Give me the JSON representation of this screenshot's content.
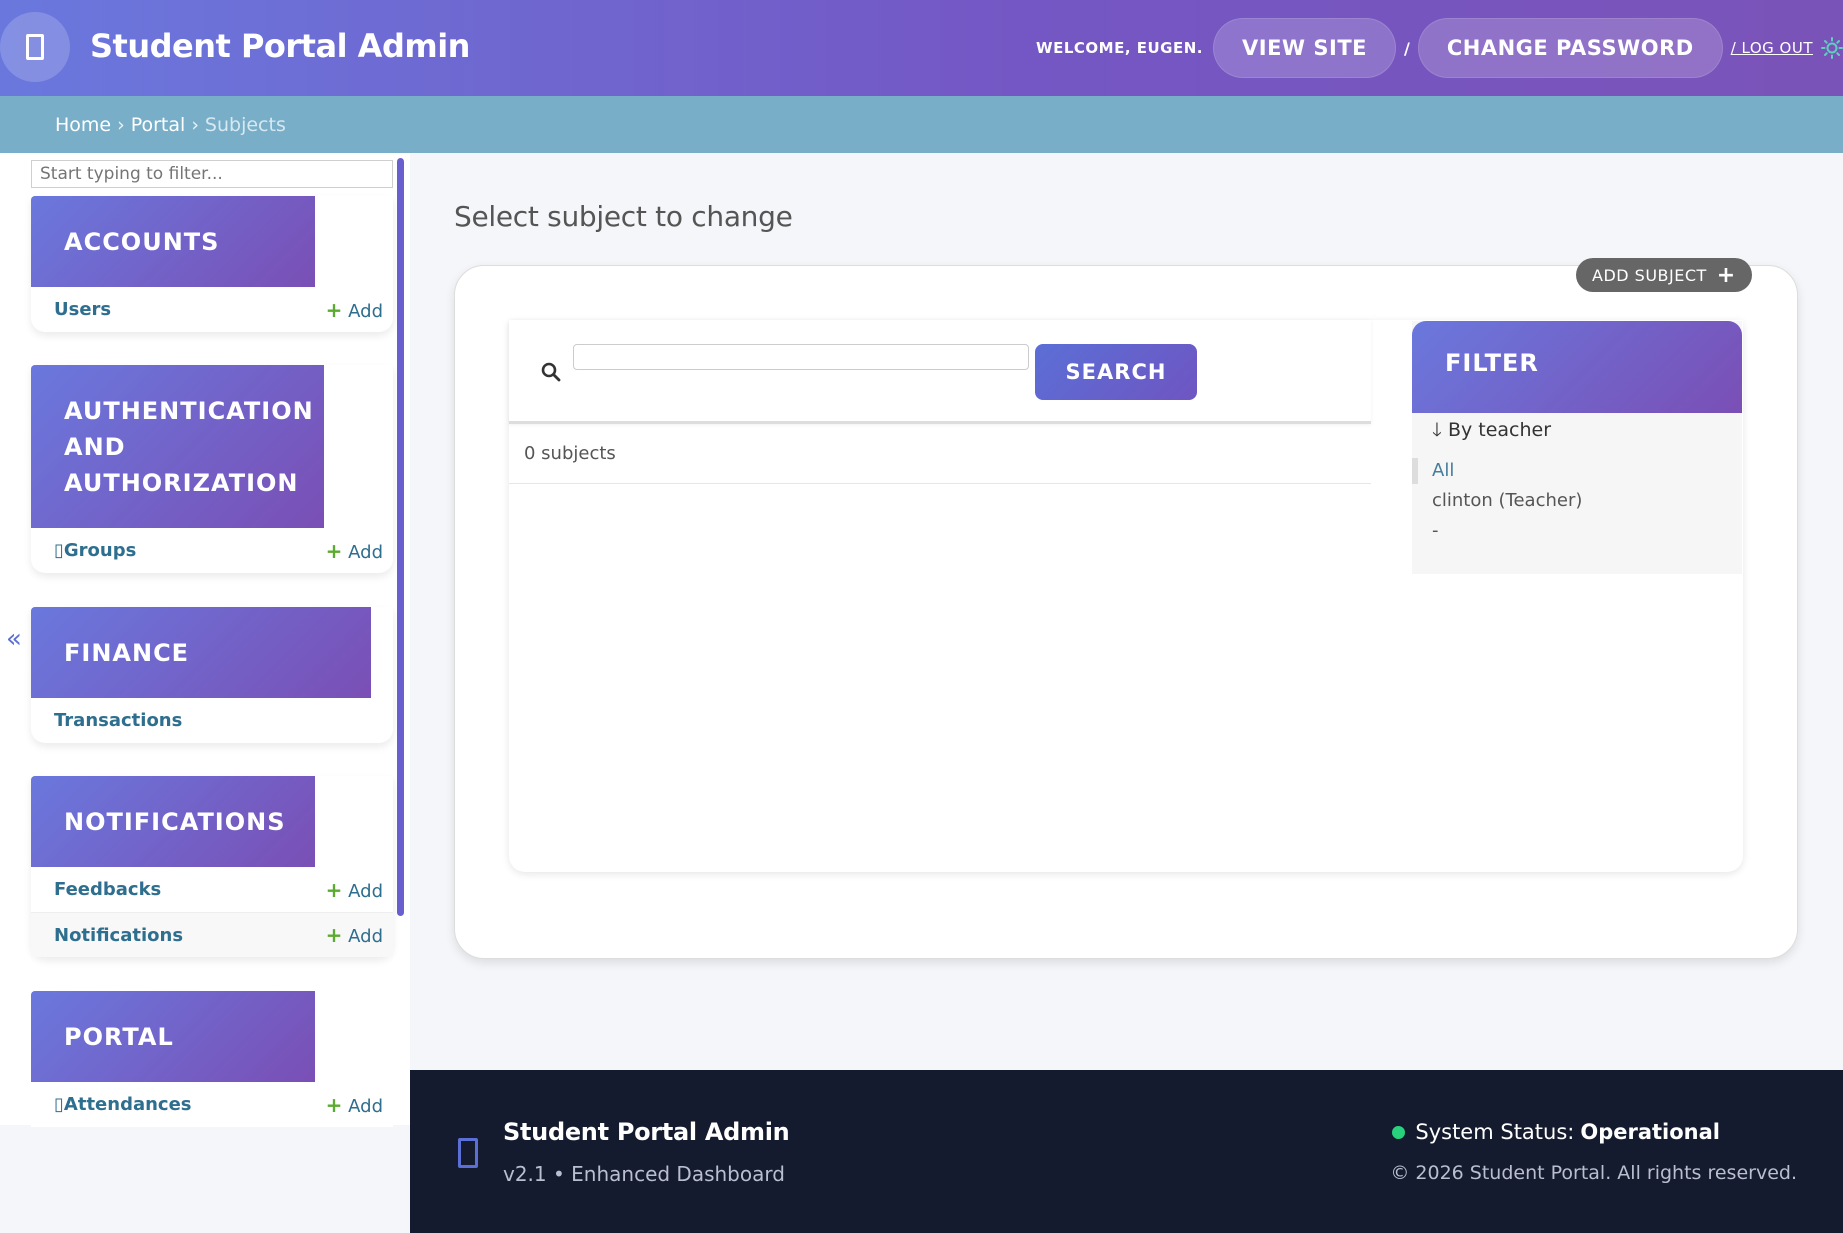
{
  "header": {
    "brand": "Student Portal Admin",
    "welcome": "WELCOME, EUGEN.",
    "view_site": "VIEW SITE",
    "separator": "/",
    "change_password": "CHANGE PASSWORD",
    "logout": "/ LOG OUT"
  },
  "breadcrumbs": {
    "home": "Home",
    "portal": "Portal",
    "current": "Subjects",
    "sep": "›"
  },
  "sidebar": {
    "filter_placeholder": "Start typing to filter...",
    "collapse": "«",
    "modules": [
      {
        "caption": "ACCOUNTS",
        "rows": [
          {
            "label": "Users",
            "add": "Add"
          }
        ]
      },
      {
        "caption_lines": [
          "AUTHENTICATION",
          "AND",
          "AUTHORIZATION"
        ],
        "rows": [
          {
            "label": "Groups",
            "add": "Add"
          }
        ]
      },
      {
        "caption": "FINANCE",
        "rows": [
          {
            "label": "Transactions"
          }
        ]
      },
      {
        "caption": "NOTIFICATIONS",
        "rows": [
          {
            "label": "Feedbacks",
            "add": "Add"
          },
          {
            "label": "Notifications",
            "add": "Add"
          }
        ]
      },
      {
        "caption": "PORTAL",
        "rows": [
          {
            "label": "Attendances",
            "add": "Add"
          }
        ]
      }
    ]
  },
  "main": {
    "title": "Select subject to change",
    "add_subject": "ADD SUBJECT",
    "search_button": "SEARCH",
    "search_value": "",
    "result_count": "0 subjects"
  },
  "filter": {
    "title": "FILTER",
    "by": "By teacher",
    "options": [
      "All",
      "clinton (Teacher)",
      "-"
    ]
  },
  "footer": {
    "title": "Student Portal Admin",
    "subtitle": "v2.1 • Enhanced Dashboard",
    "status_label": "System Status:",
    "status_value": "Operational",
    "copyright": "© 2026 Student Portal. All rights reserved."
  },
  "colors": {
    "header_start": "#6a78dd",
    "header_end": "#7a53b8",
    "breadcrumb_bg": "#79aec8",
    "link": "#2e6e8e",
    "add_plus": "#5aab2f",
    "footer_bg": "#151b2e",
    "status_ok": "#28d17c"
  }
}
